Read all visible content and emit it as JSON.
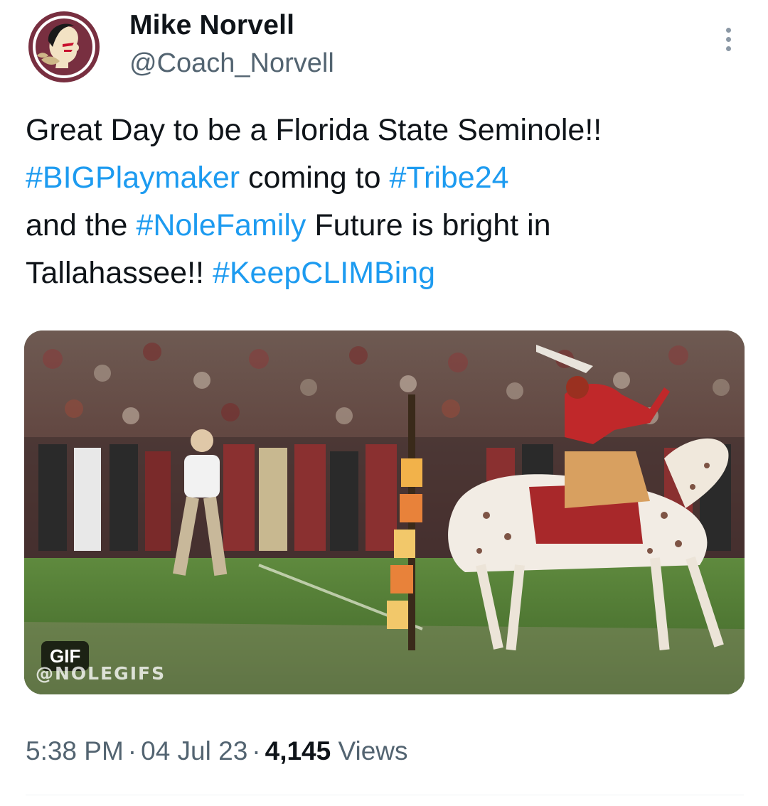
{
  "author": {
    "name": "Mike Norvell",
    "handle": "@Coach_Norvell",
    "avatar_icon": "seminole-logo-icon"
  },
  "tweet": {
    "lines": [
      [
        {
          "text": "Great Day to be a Florida State Seminole!!",
          "tag": false
        }
      ],
      [
        {
          "text": "#BIGPlaymaker",
          "tag": true
        },
        {
          "text": " coming to ",
          "tag": false
        },
        {
          "text": "#Tribe24",
          "tag": true
        }
      ],
      [
        {
          "text": "and the ",
          "tag": false
        },
        {
          "text": "#NoleFamily",
          "tag": true
        },
        {
          "text": " Future is bright in",
          "tag": false
        }
      ],
      [
        {
          "text": "Tallahassee!! ",
          "tag": false
        },
        {
          "text": "#KeepCLIMBing",
          "tag": true
        }
      ]
    ]
  },
  "media": {
    "badge": "GIF",
    "watermark": "@NOLEGIFS"
  },
  "meta": {
    "time": "5:38 PM",
    "date": "04 Jul 23",
    "views_count": "4,145",
    "views_label": "Views",
    "separator": "·"
  },
  "colors": {
    "link": "#1d9bf0",
    "secondary_text": "#536471",
    "primary_text": "#0f1419"
  }
}
